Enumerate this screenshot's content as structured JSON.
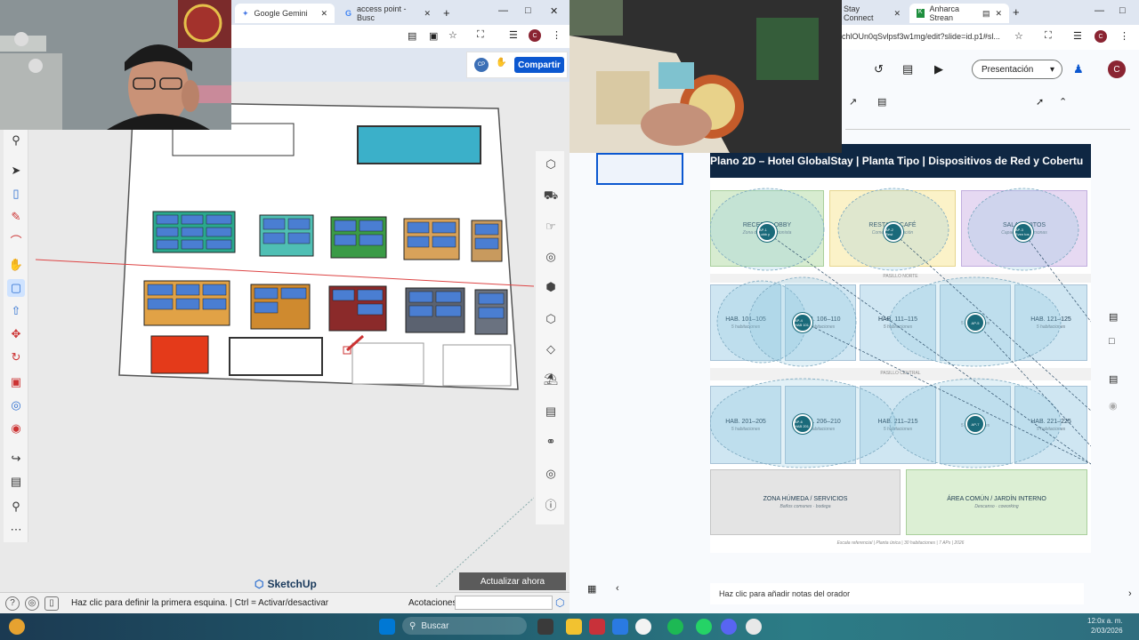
{
  "sketchup": {
    "status_text": "Haz clic para definir la primera esquina. | Ctrl = Activar/desactivar",
    "measurements_label": "Acotaciones",
    "update_button": "Actualizar ahora",
    "logo": "SketchUp",
    "left_tools": [
      "search-icon",
      "select-icon",
      "eraser-icon",
      "pencil-icon",
      "arc-icon",
      "move-icon",
      "rectangle-icon",
      "pushpull-icon",
      "move-icon",
      "rotate-icon",
      "scale-icon",
      "orbit-icon",
      "tape-icon",
      "text-icon",
      "dimension-icon",
      "zoom-icon",
      "more-icon"
    ],
    "right_tools": [
      "styles-icon",
      "components-icon",
      "scenes-icon",
      "materials-icon",
      "layers-icon",
      "entity-icon",
      "tags-icon",
      "paint-icon",
      "instructor-icon",
      "glasses-icon",
      "outliner-icon",
      "info-icon"
    ]
  },
  "browser_gemini": {
    "tabs": [
      {
        "label": "Google Gemini",
        "active": true
      },
      {
        "label": "access point - Busc",
        "active": false
      }
    ],
    "share_button": "Compartir",
    "avatar": "CP"
  },
  "slides": {
    "tabs": [
      {
        "label": "Stay Connect"
      },
      {
        "label": "Anharca Strean"
      }
    ],
    "url": "chlOUn0qSvlpsf3w1mg/edit?slide=id.p1#sl...",
    "present_button": "Presentación",
    "avatar": "C",
    "notes_placeholder": "Haz clic para añadir notas del orador",
    "slide_title": "Plano 2D – Hotel GlobalStay  |  Planta Tipo  |  Dispositivos de Red y Cobertu",
    "zones_top": [
      {
        "label": "RECEP... LOBBY",
        "sub": "Zona de ... recepcionista",
        "color": "#d7ecd0"
      },
      {
        "label": "RESTA... / CAFÉ",
        "sub": "Comedor ... atención",
        "color": "#fbf2c8"
      },
      {
        "label": "SALA ... VITOS",
        "sub": "Capacidad ... personas",
        "color": "#e6d9f2"
      }
    ],
    "corridor_1": "PASILLO NORTE",
    "corridor_2": "PASILLO CENTRAL",
    "rooms_row1": [
      {
        "label": "HAB. 101–105",
        "sub": "5 habitaciones"
      },
      {
        "label": "HAB. 106–110",
        "sub": "5 habitaciones"
      },
      {
        "label": "HAB. 111–115",
        "sub": "5 habitaciones"
      },
      {
        "label": "",
        "sub": "5 habitaciones"
      },
      {
        "label": "HAB. 121–125",
        "sub": "5 habitaciones"
      }
    ],
    "rooms_row2": [
      {
        "label": "HAB. 201–205",
        "sub": "5 habitaciones"
      },
      {
        "label": "HAB. 206–210",
        "sub": "5 habitaciones"
      },
      {
        "label": "HAB. 211–215",
        "sub": "5 habitaciones"
      },
      {
        "label": "",
        "sub": "5 habitaciones"
      },
      {
        "label": "HAB. 221–225",
        "sub": "5 habitaciones"
      }
    ],
    "zone_wet": {
      "label": "ZONA HÚMEDA / SERVICIOS",
      "sub": "Baños comunes · bodega"
    },
    "zone_common": {
      "label": "ÁREA COMÚN / JARDÍN INTERNO",
      "sub": "Descanso · coworking"
    },
    "footer": "Escala referencial  |  Planta única  |  30 habitaciones  |  7 APs  |  2026",
    "ap_labels": [
      "AP-1 Lobb y",
      "AP-2 Rest",
      "AP-3 Even tos",
      "AP-4 HAB 101",
      "AP-5",
      "AP-6 HAB 201",
      "AP-7"
    ]
  },
  "taskbar": {
    "search_placeholder": "Buscar",
    "clock_time": "12:0x a. m.",
    "clock_date": "2/03/2026"
  }
}
